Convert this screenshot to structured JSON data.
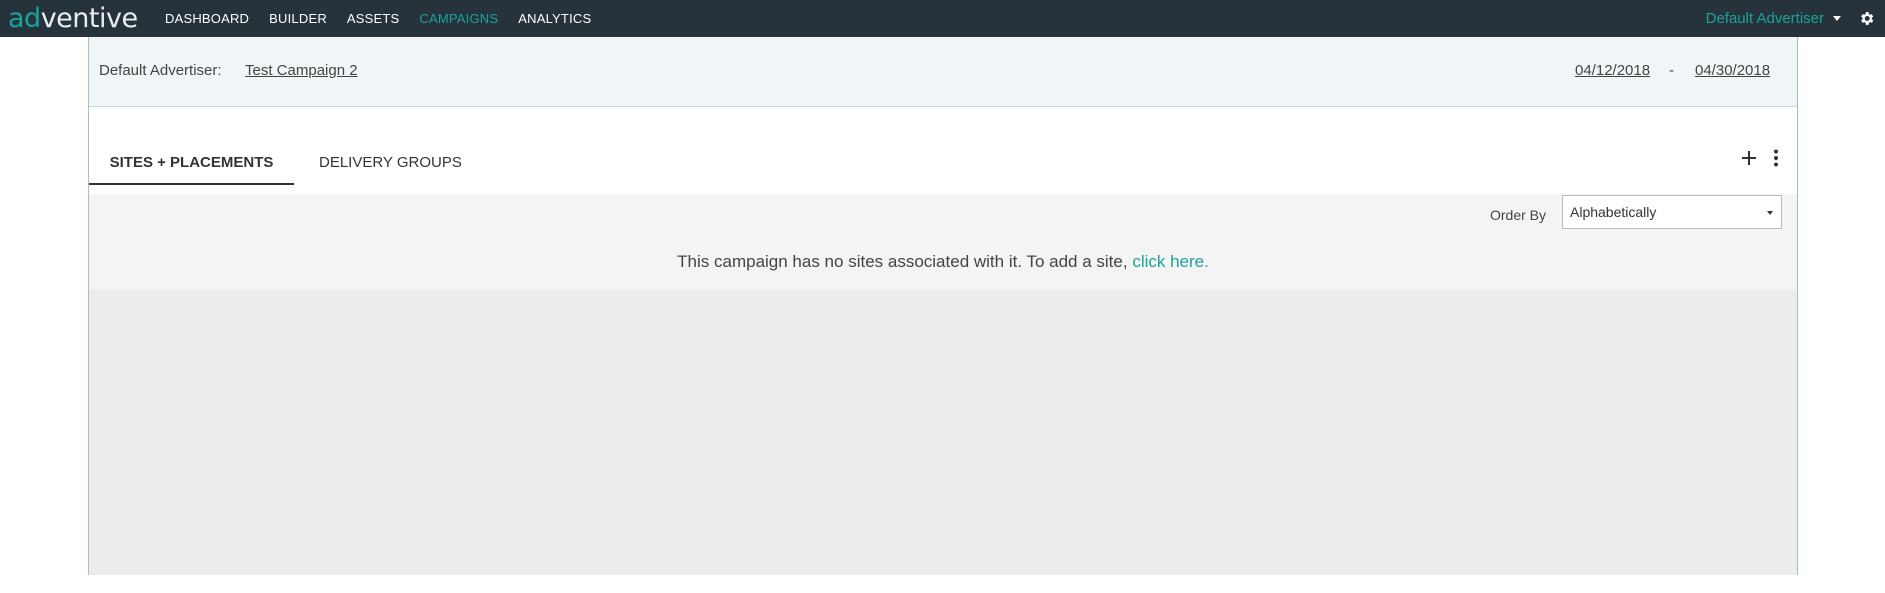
{
  "brand": {
    "logo_part1": "ad",
    "logo_part2": "ventive"
  },
  "nav": {
    "items": [
      {
        "label": "DASHBOARD",
        "active": false
      },
      {
        "label": "BUILDER",
        "active": false
      },
      {
        "label": "ASSETS",
        "active": false
      },
      {
        "label": "CAMPAIGNS",
        "active": true
      },
      {
        "label": "ANALYTICS",
        "active": false
      }
    ],
    "advertiser": "Default Advertiser",
    "settings_icon": "gear-icon"
  },
  "campaign": {
    "advertiser_label": "Default Advertiser:",
    "name": "Test Campaign 2",
    "start_date": "04/12/2018",
    "date_separator": "-",
    "end_date": "04/30/2018"
  },
  "tabs": [
    {
      "label": "SITES + PLACEMENTS",
      "active": true
    },
    {
      "label": "DELIVERY GROUPS",
      "active": false
    }
  ],
  "actions": {
    "add_icon": "plus-icon",
    "more_icon": "kebab-menu-icon"
  },
  "order": {
    "label": "Order By",
    "selected": "Alphabetically"
  },
  "empty_state": {
    "message": "This campaign has no sites associated with it. To add a site, ",
    "link": "click here."
  },
  "colors": {
    "accent": "#1aa39b",
    "topbar": "#26333a"
  }
}
